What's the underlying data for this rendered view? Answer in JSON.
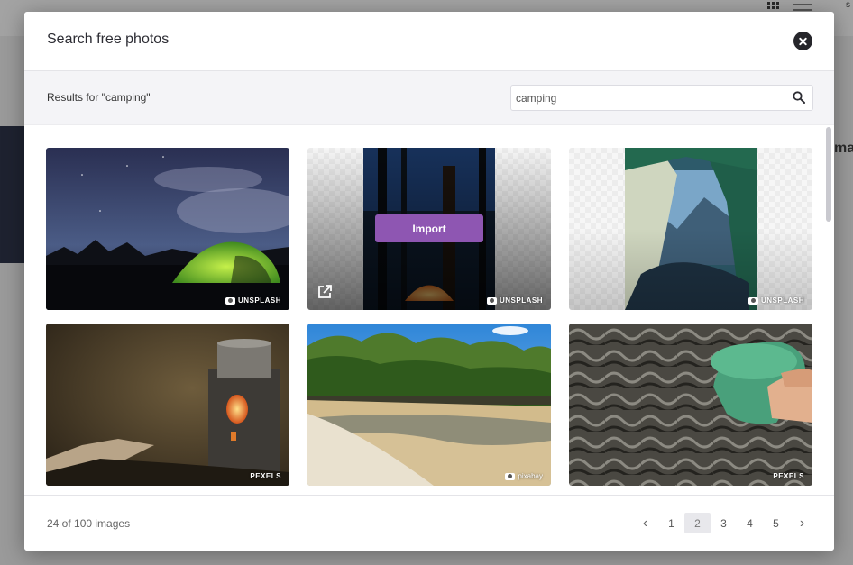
{
  "background": {
    "right_text": "mag",
    "corner_text": "s"
  },
  "modal": {
    "title": "Search free photos",
    "close_icon": "close-circle-icon"
  },
  "search": {
    "results_label": "Results for \"camping\"",
    "query": "camping",
    "placeholder": "",
    "icon": "search-icon"
  },
  "tiles": [
    {
      "source": "UNSPLASH",
      "subject": "night sky with green tent"
    },
    {
      "source": "UNSPLASH",
      "subject": "lit tent under tall trees at night",
      "hover": true,
      "import_label": "Import"
    },
    {
      "source": "UNSPLASH",
      "subject": "view from inside tent to mountains"
    },
    {
      "source": "PEXELS",
      "subject": "camp stove with kettle"
    },
    {
      "source": "pixabay",
      "subject": "riverbank with mangrove trees"
    },
    {
      "source": "PEXELS",
      "subject": "green cup dipped in stream"
    }
  ],
  "footer": {
    "count_label": "24 of 100 images",
    "pages": [
      "1",
      "2",
      "3",
      "4",
      "5"
    ],
    "current_page": "2",
    "prev_icon": "chevron-left-icon",
    "next_icon": "chevron-right-icon"
  },
  "colors": {
    "accent": "#8e56b2",
    "title_text": "#2c2c33"
  }
}
